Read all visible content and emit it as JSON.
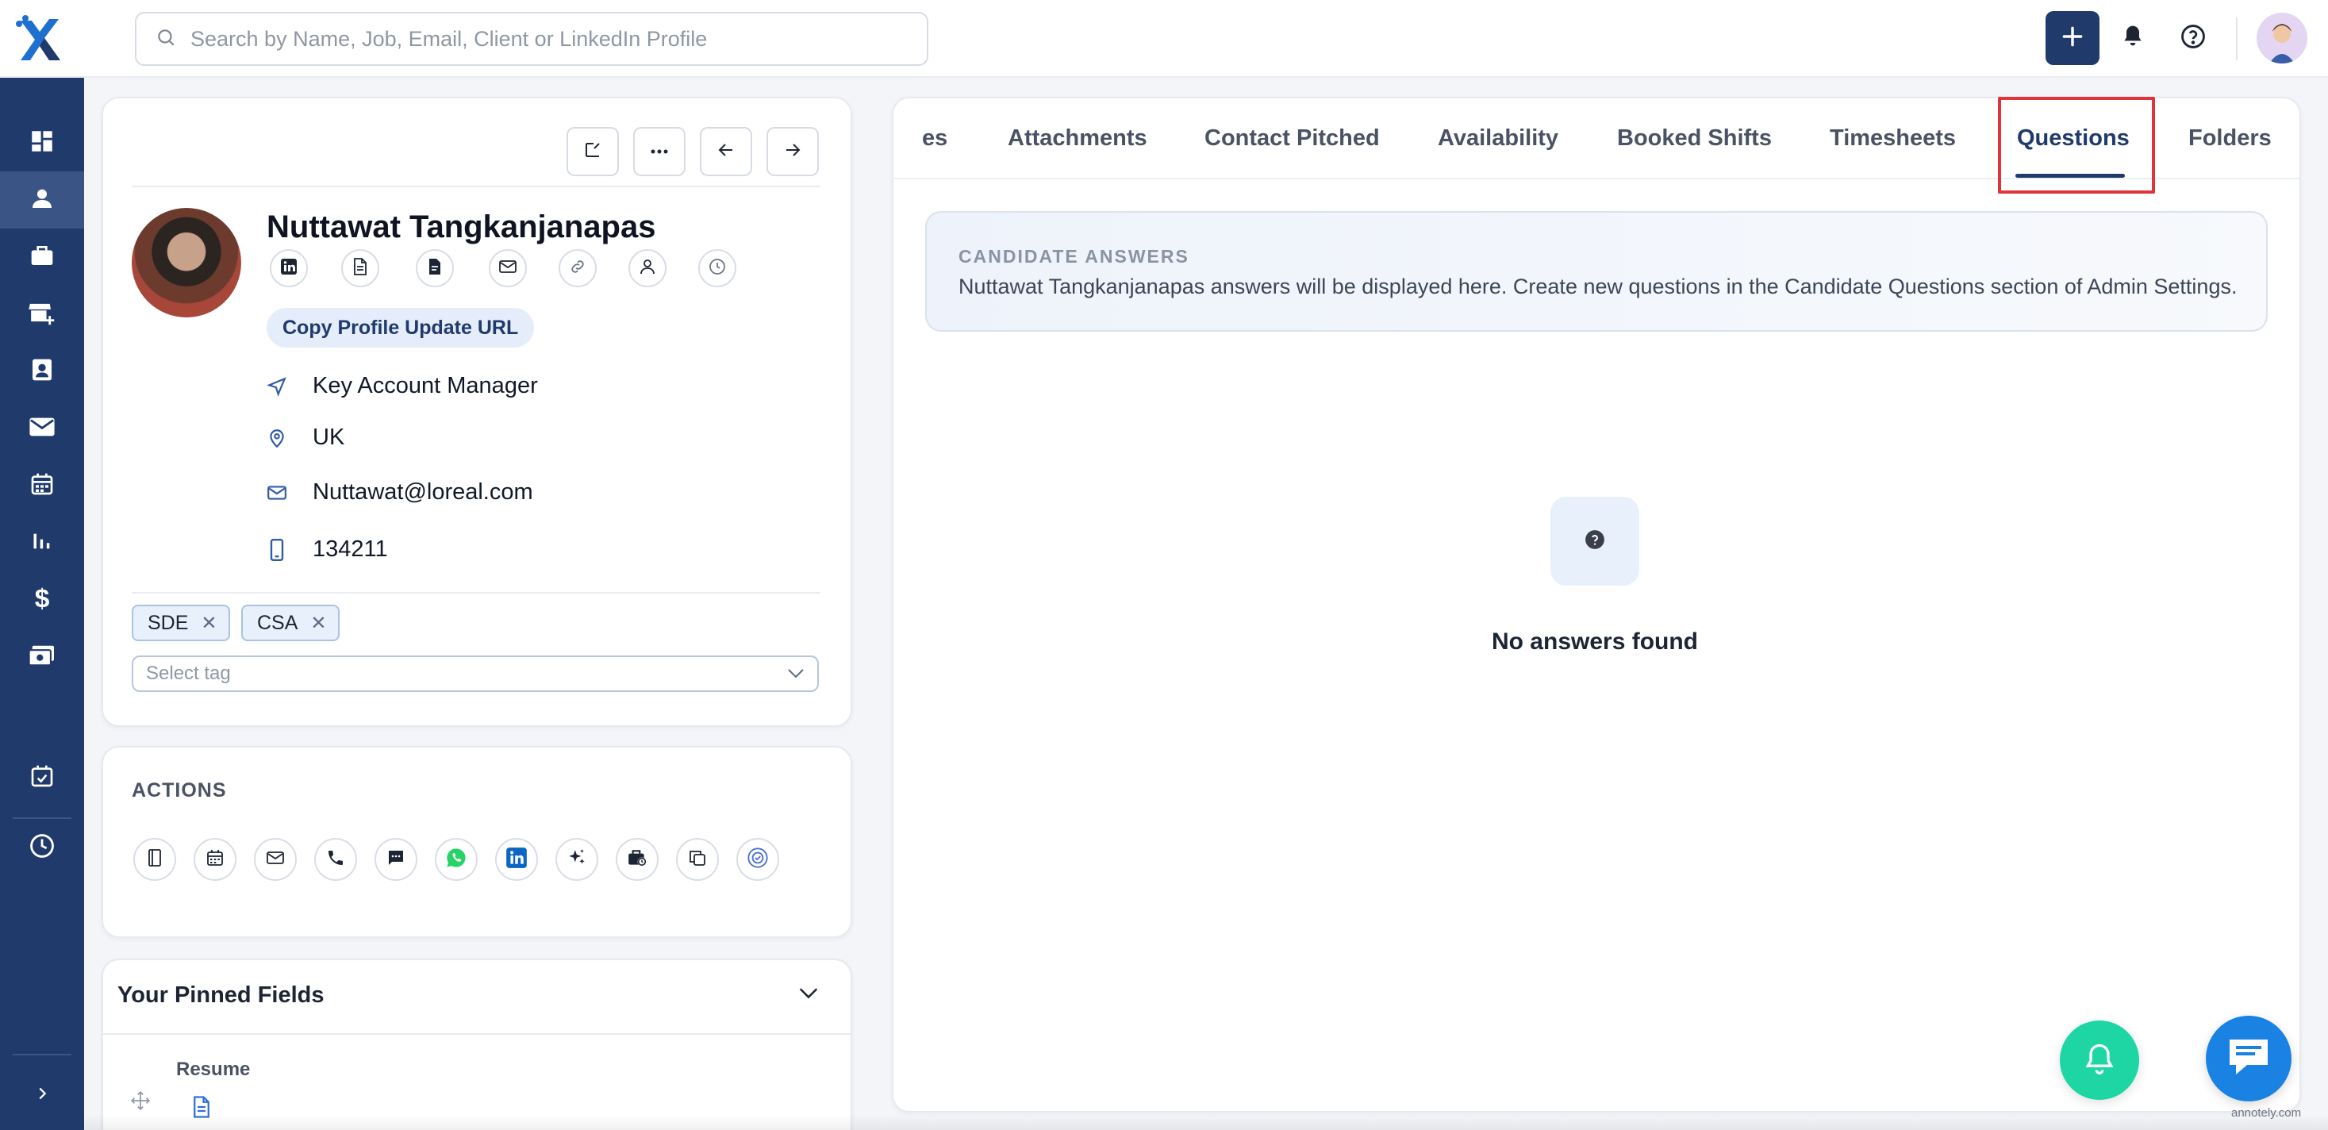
{
  "search": {
    "placeholder": "Search by Name, Job, Email, Client or LinkedIn Profile"
  },
  "colors": {
    "brand": "#1f3a6b",
    "accent_green": "#1dd6a4",
    "chat_blue": "#1a82e2",
    "highlight": "#e0333a"
  },
  "sidebar": {
    "items": [
      {
        "icon": "dashboard-icon"
      },
      {
        "icon": "candidate-icon",
        "active": true
      },
      {
        "icon": "briefcase-icon"
      },
      {
        "icon": "store-add-icon"
      },
      {
        "icon": "contact-card-icon"
      },
      {
        "icon": "mail-icon"
      },
      {
        "icon": "calendar-icon"
      },
      {
        "icon": "analytics-icon"
      },
      {
        "icon": "dollar-icon"
      },
      {
        "icon": "billing-icon"
      },
      {
        "icon": "calendar-check-icon"
      },
      {
        "icon": "clock-icon"
      },
      {
        "icon": "expand-chevron-icon"
      }
    ]
  },
  "profile": {
    "name": "Nuttawat Tangkanjanapas",
    "copy_url_label": "Copy Profile Update URL",
    "job_title": "Key Account Manager",
    "location": "UK",
    "email": "Nuttawat@loreal.com",
    "phone": "134211",
    "tags": [
      "SDE",
      "CSA"
    ],
    "select_tag_placeholder": "Select tag"
  },
  "actions": {
    "title": "ACTIONS"
  },
  "pinned": {
    "title": "Your Pinned Fields",
    "resume_label": "Resume"
  },
  "tabs": {
    "items": [
      {
        "label": "es"
      },
      {
        "label": "Attachments"
      },
      {
        "label": "Contact Pitched"
      },
      {
        "label": "Availability"
      },
      {
        "label": "Booked Shifts"
      },
      {
        "label": "Timesheets"
      },
      {
        "label": "Questions",
        "active": true
      },
      {
        "label": "Folders"
      }
    ]
  },
  "answers": {
    "title": "CANDIDATE ANSWERS",
    "text": "Nuttawat Tangkanjanapas answers will be displayed here. Create new questions in the Candidate Questions section of Admin Settings."
  },
  "empty_state": {
    "icon": "question-icon",
    "text": "No answers found"
  },
  "watermark": "annotely.com"
}
